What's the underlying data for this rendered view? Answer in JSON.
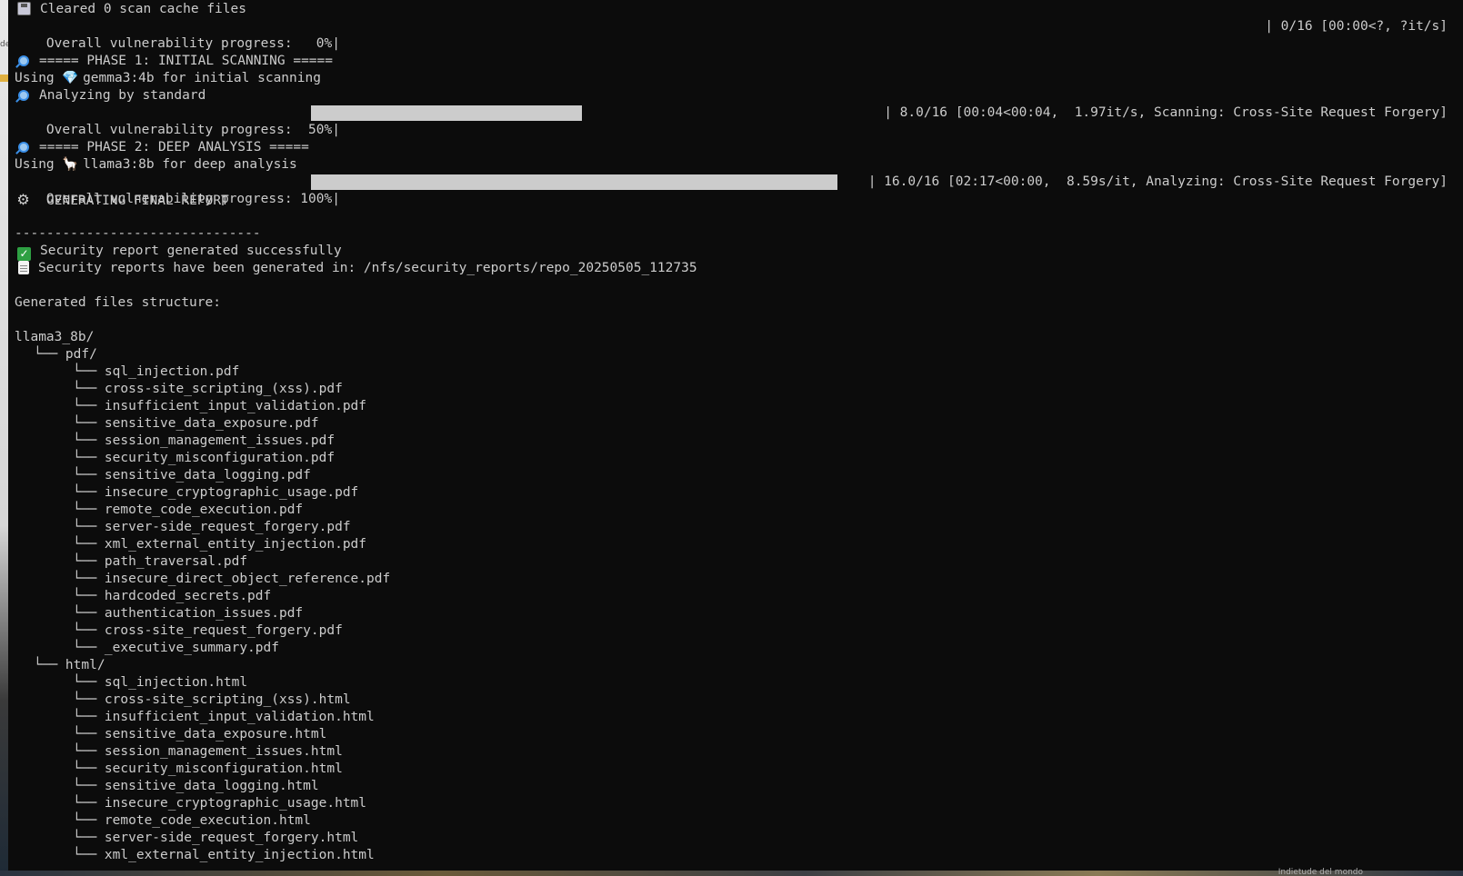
{
  "terminal": {
    "cache_line": "Cleared 0 scan cache files",
    "progress_start": {
      "label": "Overall vulnerability progress:   0%|",
      "fraction": 0.0,
      "stats": "| 0/16 [00:00<?, ?it/s]"
    },
    "phase1": {
      "header": "===== PHASE 1: INITIAL SCANNING =====",
      "using_prefix": "Using ",
      "using_model": "gemma3:4b for initial scanning",
      "analyzing": "Analyzing by standard",
      "progress": {
        "label": "Overall vulnerability progress:  50%|",
        "fraction": 0.5,
        "stats": "| 8.0/16 [00:04<00:04,  1.97it/s, Scanning: Cross-Site Request Forgery]"
      }
    },
    "phase2": {
      "header": "===== PHASE 2: DEEP ANALYSIS =====",
      "using_prefix": "Using ",
      "using_model": "llama3:8b for deep analysis",
      "progress": {
        "label": "Overall vulnerability progress: 100%|",
        "fraction": 1.0,
        "stats": "| 16.0/16 [02:17<00:00,  8.59s/it, Analyzing: Cross-Site Request Forgery]"
      }
    },
    "generating": "GENERATING FINAL REPORT",
    "separator": "-------------------------------",
    "success": "Security report generated successfully",
    "reports_location": "Security reports have been generated in: /nfs/security_reports/repo_20250505_112735",
    "structure_title": "Generated files structure:",
    "root_dir": "llama3_8b/",
    "pdf_dir": "└── pdf/",
    "html_dir": "└── html/",
    "tree_branch": "└── ",
    "pdf_files": [
      "sql_injection.pdf",
      "cross-site_scripting_(xss).pdf",
      "insufficient_input_validation.pdf",
      "sensitive_data_exposure.pdf",
      "session_management_issues.pdf",
      "security_misconfiguration.pdf",
      "sensitive_data_logging.pdf",
      "insecure_cryptographic_usage.pdf",
      "remote_code_execution.pdf",
      "server-side_request_forgery.pdf",
      "xml_external_entity_injection.pdf",
      "path_traversal.pdf",
      "insecure_direct_object_reference.pdf",
      "hardcoded_secrets.pdf",
      "authentication_issues.pdf",
      "cross-site_request_forgery.pdf",
      "_executive_summary.pdf"
    ],
    "html_files": [
      "sql_injection.html",
      "cross-site_scripting_(xss).html",
      "insufficient_input_validation.html",
      "sensitive_data_exposure.html",
      "session_management_issues.html",
      "security_misconfiguration.html",
      "sensitive_data_logging.html",
      "insecure_cryptographic_usage.html",
      "remote_code_execution.html",
      "server-side_request_forgery.html",
      "xml_external_entity_injection.html"
    ],
    "icons": {
      "cache": "floppy-disk-icon",
      "phase": "magnifier-icon",
      "gemma": "gem-icon",
      "llama": "llama-icon",
      "generating": "gear-icon",
      "success": "check-mark-icon",
      "reports": "document-icon"
    }
  },
  "background_peek": {
    "bottom_text": "Indietude del mondo"
  },
  "colors": {
    "terminal_bg": "#0c0c0c",
    "terminal_fg": "#cccccc",
    "progress_fill": "#cccccc",
    "success_green": "#2ea043",
    "icon_blue": "#3a8ee6"
  }
}
